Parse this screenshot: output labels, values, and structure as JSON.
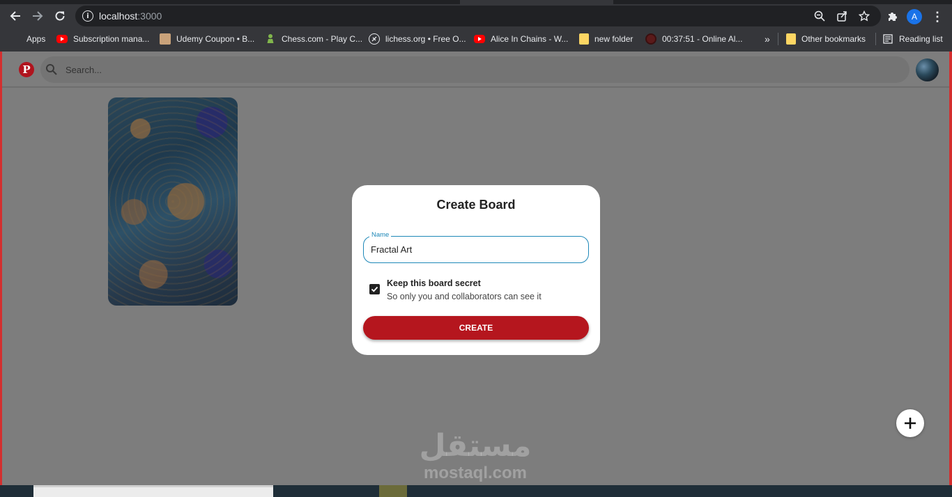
{
  "browser": {
    "url_host": "localhost",
    "url_port": ":3000",
    "profile_initial": "A",
    "bookmarks": [
      {
        "label": "Apps",
        "icon": "apps-grid-icon"
      },
      {
        "label": "Subscription mana...",
        "icon": "youtube-icon"
      },
      {
        "label": "Udemy Coupon • B...",
        "icon": "udemy-icon"
      },
      {
        "label": "Chess.com - Play C...",
        "icon": "chess-pawn-icon"
      },
      {
        "label": "lichess.org • Free O...",
        "icon": "lichess-icon"
      },
      {
        "label": "Alice In Chains - W...",
        "icon": "youtube-icon"
      },
      {
        "label": "new folder",
        "icon": "folder-icon"
      },
      {
        "label": "00:37:51 - Online Al...",
        "icon": "clock-icon"
      }
    ],
    "more_label": "»",
    "other_bookmarks": "Other bookmarks",
    "reading_list": "Reading list"
  },
  "app": {
    "search_placeholder": "Search...",
    "brand_color": "#b5161e"
  },
  "modal": {
    "title": "Create Board",
    "name_label": "Name",
    "name_value": "Fractal Art",
    "secret_title": "Keep this board secret",
    "secret_subtitle": "So only you and collaborators can see it",
    "secret_checked": true,
    "create_label": "CREATE"
  },
  "watermark": {
    "arabic": "مستقل",
    "latin": "mostaql.com"
  }
}
